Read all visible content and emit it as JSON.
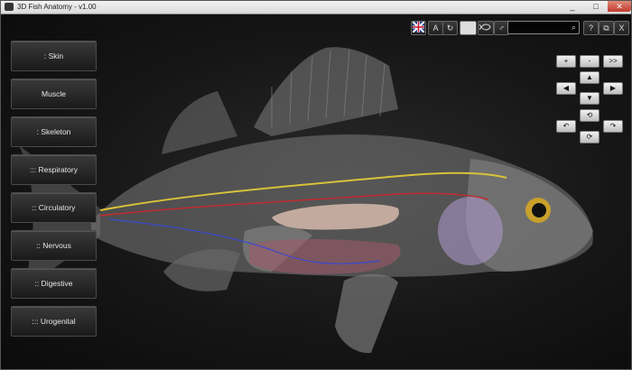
{
  "window": {
    "title": "3D Fish Anatomy - v1.00",
    "controls": {
      "minimize": "_",
      "maximize": "□",
      "close": "✕"
    }
  },
  "sidebar": {
    "items": [
      {
        "label": ": Skin"
      },
      {
        "label": "Muscle"
      },
      {
        "label": ": Skeleton"
      },
      {
        "label": "::: Respiratory"
      },
      {
        "label": ":: Circulatory"
      },
      {
        "label": ":: Nervous"
      },
      {
        "label": ":: Digestive"
      },
      {
        "label": "::: Urogenital"
      }
    ]
  },
  "toolbar": {
    "language_icon": "uk-flag-icon",
    "font_label": "A",
    "reset_glyph": "↻",
    "view_fish_icon": "fish-image-icon",
    "outline_fish_icon": "fish-outline-icon",
    "gender_glyph": "♂",
    "search": {
      "placeholder": "",
      "value": "",
      "icon": "search-icon"
    },
    "help_label": "?",
    "window_label": "⧉",
    "close_label": "X"
  },
  "navigation": {
    "zoom_in": "+",
    "zoom_out": "-",
    "forward": ">>",
    "up": "▲",
    "left": "◀",
    "right": "▶",
    "down": "▼",
    "rotate_up": "⟲",
    "rotate_left": "↶",
    "rotate_right": "↷",
    "rotate_down": "⟳"
  },
  "colors": {
    "background": "#161616",
    "button_text": "#e6e6e6",
    "nerve": "#d8c23a",
    "artery": "#c8282f",
    "vein": "#3a4ad0"
  }
}
